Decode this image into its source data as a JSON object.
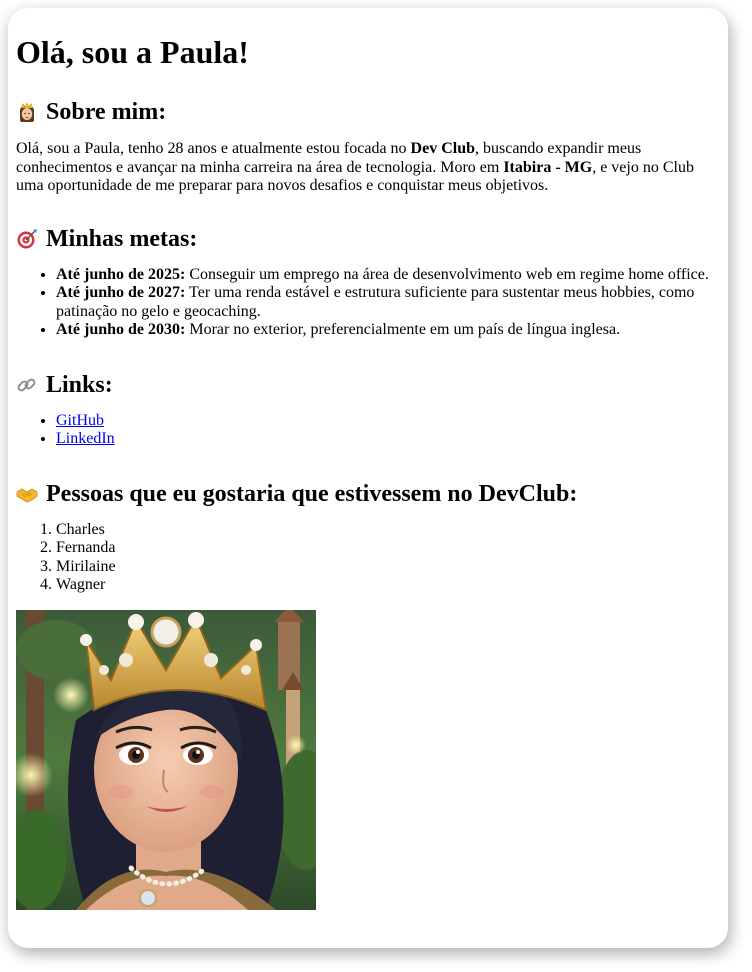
{
  "title": "Olá, sou a Paula!",
  "about": {
    "heading": "Sobre mim:",
    "icon": "princess-emoji",
    "text_1": "Olá, sou a Paula, tenho 28 anos e atualmente estou focada no ",
    "bold_1": "Dev Club",
    "text_2": ", buscando expandir meus conhecimentos e avançar na minha carreira na área de tecnologia. Moro em ",
    "bold_2": "Itabira - MG",
    "text_3": ", e vejo no Club uma oportunidade de me preparar para novos desafios e conquistar meus objetivos."
  },
  "goals": {
    "heading": "Minhas metas:",
    "icon": "target-emoji",
    "items": [
      {
        "label": "Até junho de 2025:",
        "text": " Conseguir um emprego na área de desenvolvimento web em regime home office."
      },
      {
        "label": "Até junho de 2027:",
        "text": " Ter uma renda estável e estrutura suficiente para sustentar meus hobbies, como patinação no gelo e geocaching."
      },
      {
        "label": "Até junho de 2030:",
        "text": " Morar no exterior, preferencialmente em um país de língua inglesa."
      }
    ]
  },
  "links": {
    "heading": "Links:",
    "icon": "link-emoji",
    "items": [
      "GitHub",
      "LinkedIn"
    ]
  },
  "people": {
    "heading": "Pessoas que eu gostaria que estivessem no DevClub:",
    "icon": "handshake-emoji",
    "items": [
      "Charles",
      "Fernanda",
      "Mirilaine",
      "Wagner"
    ]
  },
  "colors": {
    "link": "#0000ee",
    "background": "#ffffff"
  }
}
